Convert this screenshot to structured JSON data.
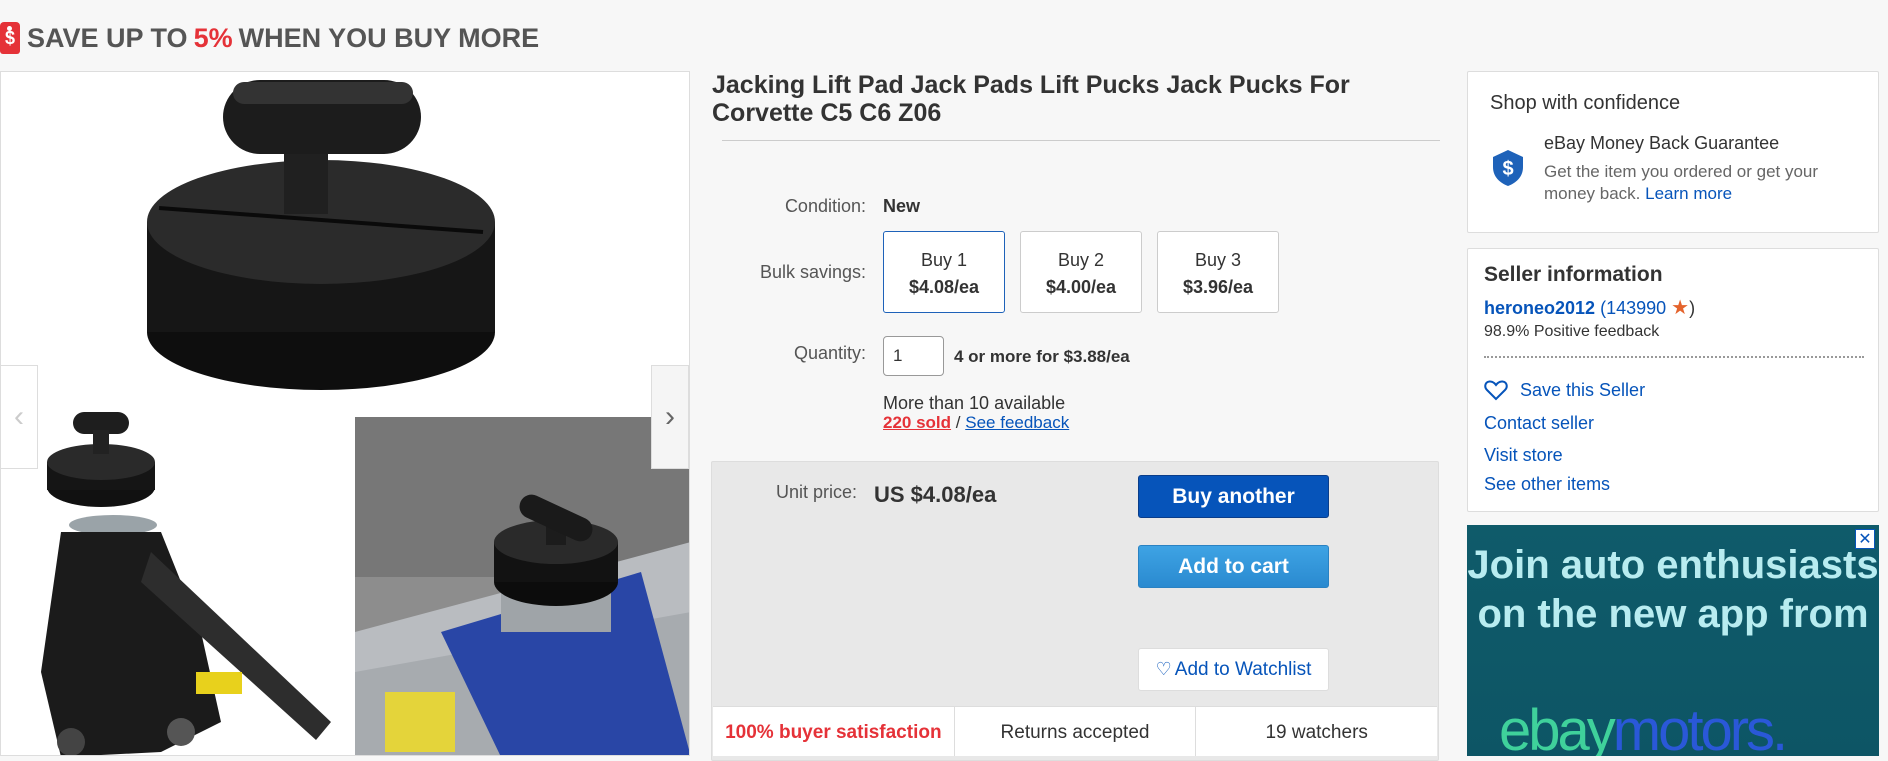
{
  "promo": {
    "prefix": "SAVE UP TO",
    "percent": "5%",
    "suffix": "WHEN YOU BUY MORE",
    "tag_icon": "$"
  },
  "product": {
    "title": "Jacking Lift Pad Jack Pads Lift Pucks Jack Pucks For Corvette C5 C6 Z06",
    "condition_label": "Condition:",
    "condition_value": "New",
    "bulk_label": "Bulk savings:",
    "bulk_options": [
      {
        "label": "Buy 1",
        "price": "$4.08/ea",
        "selected": true
      },
      {
        "label": "Buy 2",
        "price": "$4.00/ea",
        "selected": false
      },
      {
        "label": "Buy 3",
        "price": "$3.96/ea",
        "selected": false
      }
    ],
    "quantity_label": "Quantity:",
    "quantity_value": "1",
    "quantity_note": "4 or more for $3.88/ea",
    "availability": "More than 10 available",
    "sold": "220 sold",
    "sold_sep": "/",
    "see_feedback": "See feedback"
  },
  "buybox": {
    "unit_price_label": "Unit price:",
    "unit_price_value": "US $4.08/ea",
    "buy_label": "Buy another",
    "cart_label": "Add to cart",
    "watch_label": "Add to Watchlist",
    "stats": [
      "100% buyer satisfaction",
      "Returns accepted",
      "19 watchers"
    ]
  },
  "confidence": {
    "title": "Shop with confidence",
    "guarantee_title": "eBay Money Back Guarantee",
    "guarantee_desc": "Get the item you ordered or get your money back.",
    "learn_more": "Learn more"
  },
  "seller": {
    "title": "Seller information",
    "name": "heroneo2012",
    "open_paren": "(",
    "score": "143990",
    "close_paren": ")",
    "feedback": "98.9% Positive feedback",
    "save_seller": "Save this Seller",
    "contact": "Contact seller",
    "visit_store": "Visit store",
    "other_items": "See other items"
  },
  "ad": {
    "close": "✕",
    "headline": "Join auto enthusiasts on the new app from",
    "logo_ebay": "ebay",
    "logo_motors": "motors."
  },
  "colors": {
    "ebay_blue": "#0654ba",
    "ebay_red": "#e53238",
    "cart_blue": "#3498db",
    "ad_bg": "#0f5b6a"
  }
}
